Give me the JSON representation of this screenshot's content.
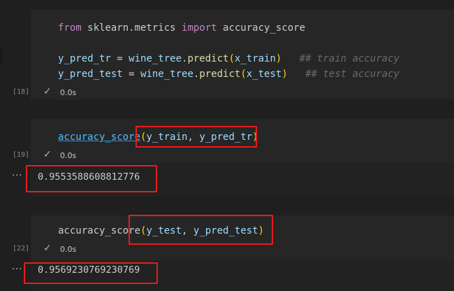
{
  "cells": [
    {
      "execution_count": "[18]",
      "lines": [
        {
          "tokens": [
            {
              "cls": "kw",
              "text": "from"
            },
            {
              "cls": "",
              "text": " sklearn.metrics "
            },
            {
              "cls": "kw",
              "text": "import"
            },
            {
              "cls": "",
              "text": " accuracy_score"
            }
          ]
        },
        {
          "tokens": [
            {
              "cls": "var",
              "text": "y_pred_tr"
            },
            {
              "cls": "",
              "text": " = "
            },
            {
              "cls": "var",
              "text": "wine_tree"
            },
            {
              "cls": "",
              "text": "."
            },
            {
              "cls": "fn",
              "text": "predict"
            },
            {
              "cls": "paren",
              "text": "("
            },
            {
              "cls": "var",
              "text": "x_train"
            },
            {
              "cls": "paren",
              "text": ")"
            },
            {
              "cls": "cmt",
              "text": "   ## train accuracy"
            }
          ]
        },
        {
          "tokens": [
            {
              "cls": "var",
              "text": "y_pred_test"
            },
            {
              "cls": "",
              "text": " = "
            },
            {
              "cls": "var",
              "text": "wine_tree"
            },
            {
              "cls": "",
              "text": "."
            },
            {
              "cls": "fn",
              "text": "predict"
            },
            {
              "cls": "paren",
              "text": "("
            },
            {
              "cls": "var",
              "text": "x_test"
            },
            {
              "cls": "paren",
              "text": ")"
            },
            {
              "cls": "cmt",
              "text": "   ## test accuracy"
            }
          ]
        }
      ],
      "status_icon": "check-icon",
      "time": "0.0s"
    },
    {
      "execution_count": "[19]",
      "lines": [
        {
          "tokens": [
            {
              "cls": "link",
              "text": "accuracy_score"
            },
            {
              "cls": "paren",
              "text": "("
            },
            {
              "cls": "var",
              "text": "y_train"
            },
            {
              "cls": "",
              "text": ", "
            },
            {
              "cls": "var",
              "text": "y_pred_tr"
            },
            {
              "cls": "paren",
              "text": ")"
            }
          ]
        }
      ],
      "status_icon": "check-icon",
      "time": "0.0s",
      "output": "0.9553588608812776"
    },
    {
      "execution_count": "[22]",
      "lines": [
        {
          "tokens": [
            {
              "cls": "",
              "text": "accuracy_score"
            },
            {
              "cls": "paren",
              "text": "("
            },
            {
              "cls": "var",
              "text": "y_test"
            },
            {
              "cls": "",
              "text": ", "
            },
            {
              "cls": "var",
              "text": "y_pred_test"
            },
            {
              "cls": "paren",
              "text": ")"
            }
          ]
        }
      ],
      "status_icon": "check-icon",
      "time": "0.0s",
      "output": "0.9569230769230769"
    }
  ],
  "output_more_glyph": "...",
  "check_glyph": "✓",
  "highlight_color": "#e81c1c"
}
